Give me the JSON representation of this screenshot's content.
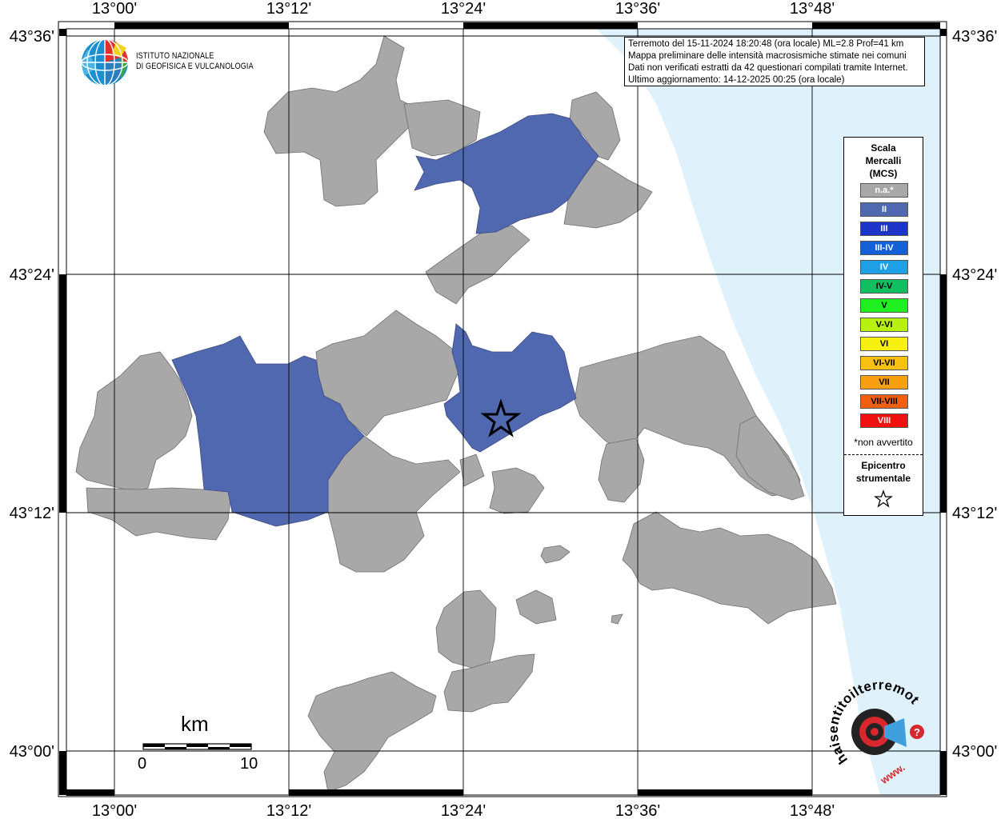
{
  "map": {
    "lon_labels": [
      "13°00'",
      "13°12'",
      "13°24'",
      "13°36'",
      "13°48'"
    ],
    "lat_labels": [
      "43°36'",
      "43°24'",
      "43°12'",
      "43°00'"
    ]
  },
  "info": {
    "line1": "Terremoto del 15-11-2024 18:20:48 (ora locale) ML=2.8 Prof=41 km",
    "line2": "Mappa preliminare delle intensità macrosismiche stimate nei comuni",
    "line3": "Dati non verificati estratti da 42 questionari compilati tramite Internet.",
    "line4": "Ultimo aggiornamento: 14-12-2025 00:25 (ora locale)"
  },
  "logo": {
    "ingv_line1": "ISTITUTO NAZIONALE",
    "ingv_line2": "DI GEOFISICA E VULCANOLOGIA",
    "hsit_text": "haisentitoilterremoto.it",
    "hsit_www": "www.",
    "hsit_question": "?"
  },
  "legend": {
    "title_line1": "Scala",
    "title_line2": "Mercalli",
    "title_line3": "(MCS)",
    "items": [
      {
        "label": "n.a.*",
        "color": "#a8a8a8"
      },
      {
        "label": "II",
        "color": "#5068b0"
      },
      {
        "label": "III",
        "color": "#1a35c8"
      },
      {
        "label": "III-IV",
        "color": "#1460d8"
      },
      {
        "label": "IV",
        "color": "#1ea0e6"
      },
      {
        "label": "IV-V",
        "color": "#10c060"
      },
      {
        "label": "V",
        "color": "#20f020"
      },
      {
        "label": "V-VI",
        "color": "#b8f010"
      },
      {
        "label": "VI",
        "color": "#f8f010"
      },
      {
        "label": "VI-VII",
        "color": "#f8c010"
      },
      {
        "label": "VII",
        "color": "#f8a010"
      },
      {
        "label": "VII-VIII",
        "color": "#f06010"
      },
      {
        "label": "VIII",
        "color": "#f01010"
      }
    ],
    "na_note": "*non avvertito",
    "epicenter_line1": "Epicentro",
    "epicenter_line2": "strumentale"
  },
  "scale": {
    "unit": "km",
    "start": "0",
    "end": "10"
  },
  "colors": {
    "gray_area": "#a8a8a8",
    "intensity_ii": "#5068b0",
    "sea": "#dff2fc"
  }
}
